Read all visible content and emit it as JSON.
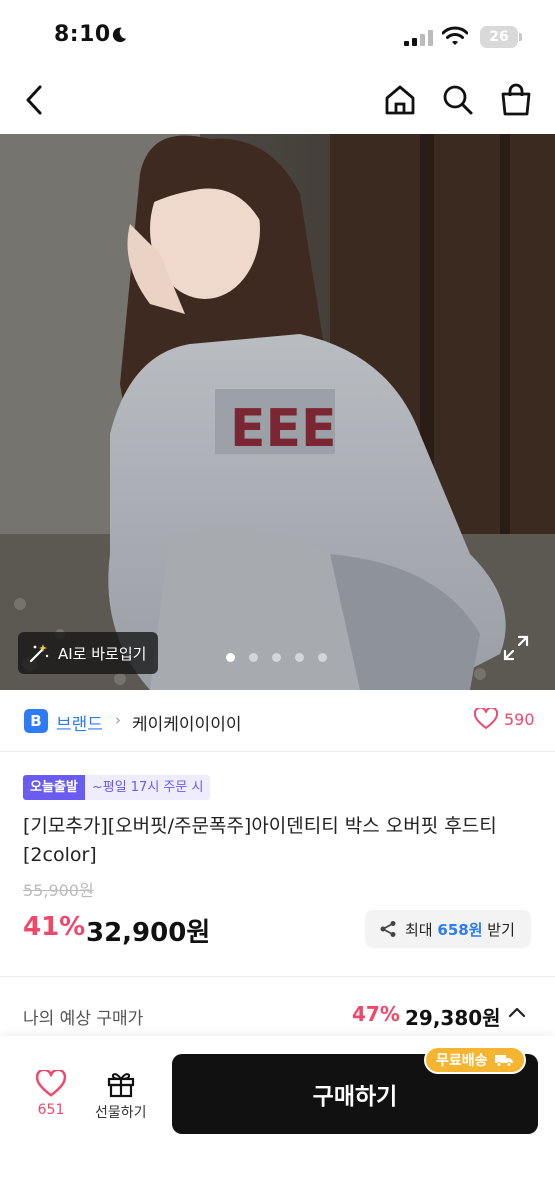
{
  "status_bar": {
    "time": "8:10",
    "battery": "26",
    "battery_level_percent": 26
  },
  "nav": {
    "icons": [
      "back-icon",
      "home-icon",
      "search-icon",
      "shopping-bag-icon"
    ]
  },
  "photo": {
    "ai_button_label": "AI로 바로입기",
    "carousel_count": 5,
    "carousel_active_index": 0,
    "hoodie_print": "EEE"
  },
  "brand": {
    "badge": "B",
    "label": "브랜드",
    "chevron": "›",
    "name": "케이케이이이이",
    "likes": "590"
  },
  "product": {
    "tag_main": "오늘출발",
    "tag_sub": "~평일 17시 주문 시",
    "title": "[기모추가][오버핏/주문폭주]아이덴티티 박스 오버핏 후드티[2color]",
    "original_price": "55,900원",
    "discount": "41%",
    "price": "32,900원",
    "reward_prefix": "최대",
    "reward_amount": "658원",
    "reward_suffix": "받기"
  },
  "estimate": {
    "label": "나의 예상 구매가",
    "discount": "47%",
    "price": "29,380원"
  },
  "bottom_bar": {
    "like_count": "651",
    "gift_label": "선물하기",
    "buy_label": "구매하기",
    "free_shipping": "무료배송"
  },
  "colors": {
    "accent_pink": "#f0486a",
    "brand_blue": "#2e7bf6",
    "tag_purple": "#6a5cf0",
    "shipping_yellow": "#f5b531"
  }
}
